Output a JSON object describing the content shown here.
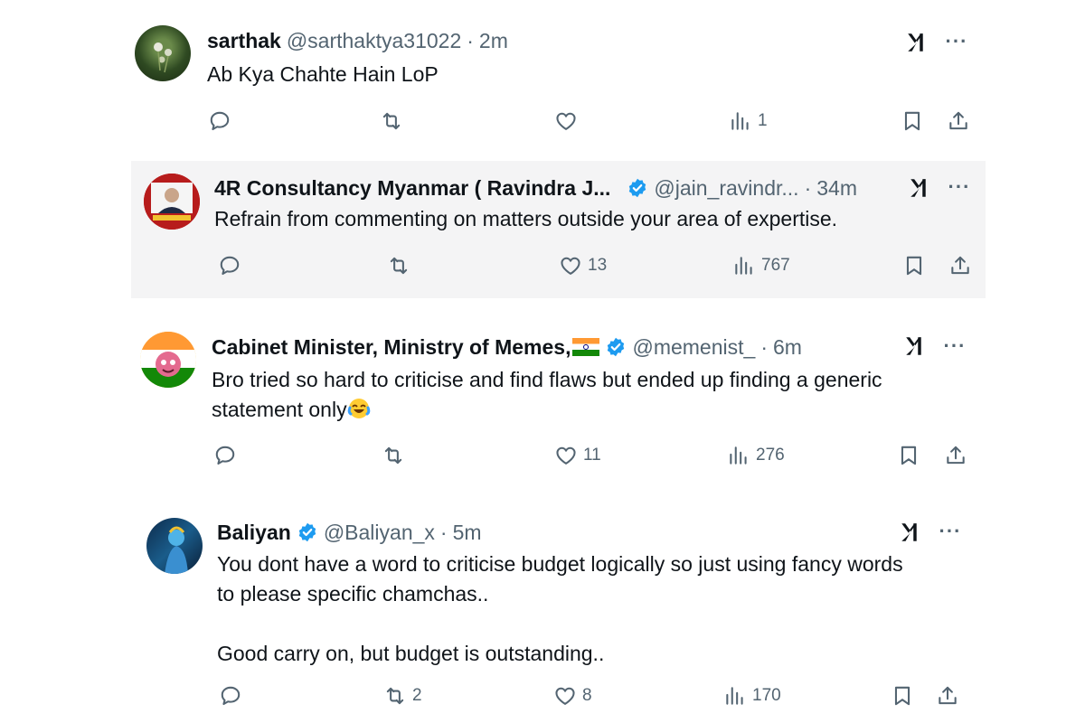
{
  "tweets": [
    {
      "name": "sarthak",
      "handle": "@sarthaktya31022",
      "dot": "·",
      "time": "2m",
      "lines": [
        "Ab Kya Chahte Hain LoP"
      ],
      "replies": "",
      "retweets": "",
      "likes": "",
      "views": "1"
    },
    {
      "name": "4R Consultancy Myanmar ( Ravindra J...",
      "handle": "@jain_ravindr...",
      "dot": "·",
      "time": "34m",
      "lines": [
        "Refrain from commenting on matters outside your area of expertise."
      ],
      "replies": "",
      "retweets": "",
      "likes": "13",
      "views": "767"
    },
    {
      "name": "Cabinet Minister, Ministry of Memes,",
      "handle": "@memenist_",
      "dot": "·",
      "time": "6m",
      "lines": [
        "Bro tried so hard to criticise and find flaws but ended up finding a generic",
        "statement only"
      ],
      "replies": "",
      "retweets": "",
      "likes": "11",
      "views": "276"
    },
    {
      "name": "Baliyan",
      "handle": "@Baliyan_x",
      "dot": "·",
      "time": "5m",
      "lines": [
        "You dont have a word to criticise budget logically  so just using fancy words",
        "to please specific chamchas..",
        "",
        "Good carry on, but budget is outstanding.."
      ],
      "replies": "",
      "retweets": "2",
      "likes": "8",
      "views": "170"
    }
  ],
  "icons": {
    "reply": "reply-icon",
    "retweet": "retweet-icon",
    "like": "heart-icon",
    "views": "views-icon",
    "bookmark": "bookmark-icon",
    "share": "share-icon",
    "grok": "grok-icon",
    "more": "more-icon",
    "verified": "verified-badge-icon"
  },
  "more_glyph": "···",
  "colors": {
    "text": "#0f1419",
    "secondary": "#536471",
    "verified": "#1d9bf0",
    "highlight_bg": "#f4f4f5"
  }
}
